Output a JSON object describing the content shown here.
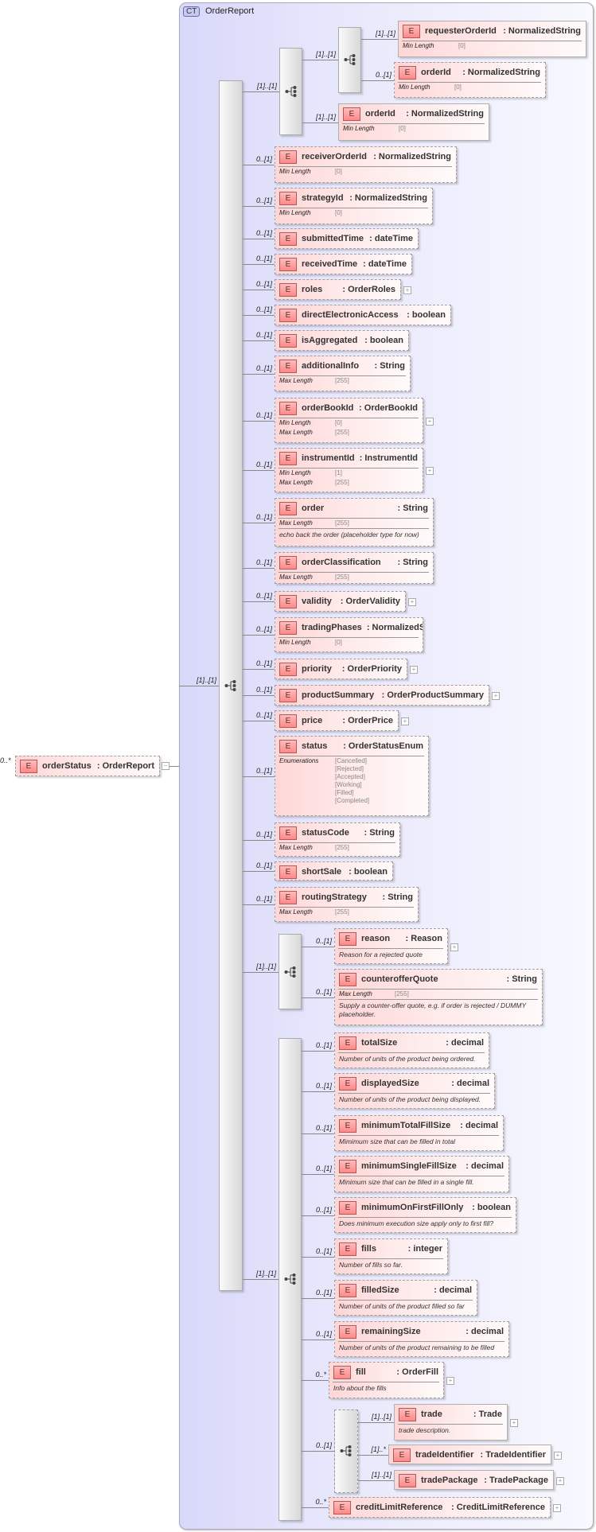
{
  "complex_type": {
    "badge": "CT",
    "name": "OrderReport"
  },
  "root": {
    "occurs": "0..*",
    "badge": "E",
    "name": "orderStatus",
    "type": "OrderReport",
    "expanded": true
  },
  "compositors": [
    {
      "kind": "sequence",
      "occurs": "[1]..[1]"
    },
    {
      "kind": "sequence",
      "occurs": "[1]..[1]"
    },
    {
      "kind": "choice",
      "occurs": "[1]..[1]"
    },
    {
      "kind": "choice",
      "occurs": "[1]..[1]"
    },
    {
      "kind": "sequence",
      "occurs": "[1]..[1]"
    },
    {
      "kind": "sequence",
      "occurs": "0..[1]"
    }
  ],
  "elements": [
    {
      "name": "requesterOrderId",
      "type": "NormalizedString",
      "occurs": "[1]..[1]",
      "optional": false,
      "facets": [
        {
          "label": "Min Length",
          "value": "[0]"
        }
      ]
    },
    {
      "name": "orderId",
      "type": "NormalizedString",
      "occurs": "0..[1]",
      "optional": true,
      "facets": [
        {
          "label": "Min Length",
          "value": "[0]"
        }
      ]
    },
    {
      "name": "orderId",
      "type": "NormalizedString",
      "occurs": "[1]..[1]",
      "optional": false,
      "facets": [
        {
          "label": "Min Length",
          "value": "[0]"
        }
      ]
    },
    {
      "name": "receiverOrderId",
      "type": "NormalizedString",
      "occurs": "0..[1]",
      "optional": true,
      "facets": [
        {
          "label": "Min Length",
          "value": "[0]"
        }
      ]
    },
    {
      "name": "strategyId",
      "type": "NormalizedString",
      "occurs": "0..[1]",
      "optional": true,
      "facets": [
        {
          "label": "Min Length",
          "value": "[0]"
        }
      ]
    },
    {
      "name": "submittedTime",
      "type": "dateTime",
      "occurs": "0..[1]",
      "optional": true
    },
    {
      "name": "receivedTime",
      "type": "dateTime",
      "occurs": "0..[1]",
      "optional": true
    },
    {
      "name": "roles",
      "type": "OrderRoles",
      "occurs": "0..[1]",
      "optional": true,
      "expandable": true
    },
    {
      "name": "directElectronicAccess",
      "type": "boolean",
      "occurs": "0..[1]",
      "optional": true
    },
    {
      "name": "isAggregated",
      "type": "boolean",
      "occurs": "0..[1]",
      "optional": true
    },
    {
      "name": "additionalInfo",
      "type": "String",
      "occurs": "0..[1]",
      "optional": true,
      "facets": [
        {
          "label": "Max Length",
          "value": "[255]"
        }
      ]
    },
    {
      "name": "orderBookId",
      "type": "OrderBookId",
      "occurs": "0..[1]",
      "optional": true,
      "expandable": true,
      "facets": [
        {
          "label": "Min Length",
          "value": "[0]"
        },
        {
          "label": "Max Length",
          "value": "[255]"
        }
      ]
    },
    {
      "name": "instrumentId",
      "type": "InstrumentId",
      "occurs": "0..[1]",
      "optional": true,
      "expandable": true,
      "facets": [
        {
          "label": "Min Length",
          "value": "[1]"
        },
        {
          "label": "Max Length",
          "value": "[255]"
        }
      ]
    },
    {
      "name": "order",
      "type": "String",
      "occurs": "0..[1]",
      "optional": true,
      "facets": [
        {
          "label": "Max Length",
          "value": "[255]"
        }
      ],
      "description": "echo back the order (placeholder type for now)"
    },
    {
      "name": "orderClassification",
      "type": "String",
      "occurs": "0..[1]",
      "optional": true,
      "facets": [
        {
          "label": "Max Length",
          "value": "[255]"
        }
      ]
    },
    {
      "name": "validity",
      "type": "OrderValidity",
      "occurs": "0..[1]",
      "optional": true,
      "expandable": true
    },
    {
      "name": "tradingPhases",
      "type": "NormalizedString",
      "occurs": "0..[1]",
      "optional": true,
      "facets": [
        {
          "label": "Min Length",
          "value": "[0]"
        }
      ]
    },
    {
      "name": "priority",
      "type": "OrderPriority",
      "occurs": "0..[1]",
      "optional": true,
      "expandable": true
    },
    {
      "name": "productSummary",
      "type": "OrderProductSummary",
      "occurs": "0..[1]",
      "optional": true,
      "expandable": true
    },
    {
      "name": "price",
      "type": "OrderPrice",
      "occurs": "0..[1]",
      "optional": true,
      "expandable": true
    },
    {
      "name": "status",
      "type": "OrderStatusEnum",
      "occurs": "0..[1]",
      "optional": true,
      "facets": [
        {
          "label": "Enumerations",
          "values": [
            "[Cancelled]",
            "[Rejected]",
            "[Accepted]",
            "[Working]",
            "[Filled]",
            "[Completed]"
          ]
        }
      ]
    },
    {
      "name": "statusCode",
      "type": "String",
      "occurs": "0..[1]",
      "optional": true,
      "facets": [
        {
          "label": "Max Length",
          "value": "[255]"
        }
      ]
    },
    {
      "name": "shortSale",
      "type": "boolean",
      "occurs": "0..[1]",
      "optional": true
    },
    {
      "name": "routingStrategy",
      "type": "String",
      "occurs": "0..[1]",
      "optional": true,
      "facets": [
        {
          "label": "Max Length",
          "value": "[255]"
        }
      ]
    },
    {
      "name": "reason",
      "type": "Reason",
      "occurs": "0..[1]",
      "optional": true,
      "expandable": true,
      "description": "Reason for a rejected quote"
    },
    {
      "name": "counterofferQuote",
      "type": "String",
      "occurs": "0..[1]",
      "optional": true,
      "facets": [
        {
          "label": "Max Length",
          "value": "[255]"
        }
      ],
      "description": "Supply a counter-offer quote, e.g. if order is rejected / DUMMY placeholder."
    },
    {
      "name": "totalSize",
      "type": "decimal",
      "occurs": "0..[1]",
      "optional": true,
      "description": "Number of units of the product being ordered."
    },
    {
      "name": "displayedSize",
      "type": "decimal",
      "occurs": "0..[1]",
      "optional": true,
      "description": "Number of units of the product being displayed."
    },
    {
      "name": "minimumTotalFillSize",
      "type": "decimal",
      "occurs": "0..[1]",
      "optional": true,
      "description": "Mimimum size that can be filled in total"
    },
    {
      "name": "minimumSingleFillSize",
      "type": "decimal",
      "occurs": "0..[1]",
      "optional": true,
      "description": "Minimum size that can be filled in a single fill."
    },
    {
      "name": "minimumOnFirstFillOnly",
      "type": "boolean",
      "occurs": "0..[1]",
      "optional": true,
      "description": "Does minimum execution size apply only to first fill?"
    },
    {
      "name": "fills",
      "type": "integer",
      "occurs": "0..[1]",
      "optional": true,
      "description": "Number of fills so far."
    },
    {
      "name": "filledSize",
      "type": "decimal",
      "occurs": "0..[1]",
      "optional": true,
      "description": "Number of units of the product filled so far"
    },
    {
      "name": "remainingSize",
      "type": "decimal",
      "occurs": "0..[1]",
      "optional": true,
      "description": "Number of units of the product remaining to be filled"
    },
    {
      "name": "fill",
      "type": "OrderFill",
      "occurs": "0..*",
      "optional": true,
      "expandable": true,
      "description": "Info about the fills"
    },
    {
      "name": "trade",
      "type": "Trade",
      "occurs": "[1]..[1]",
      "optional": false,
      "expandable": true,
      "description": "trade description."
    },
    {
      "name": "tradeIdentifier",
      "type": "TradeIdentifier",
      "occurs": "[1]..*",
      "optional": false,
      "expandable": true
    },
    {
      "name": "tradePackage",
      "type": "TradePackage",
      "occurs": "[1]..[1]",
      "optional": false,
      "expandable": true
    },
    {
      "name": "creditLimitReference",
      "type": "CreditLimitReference",
      "occurs": "0..*",
      "optional": true,
      "expandable": true
    }
  ]
}
